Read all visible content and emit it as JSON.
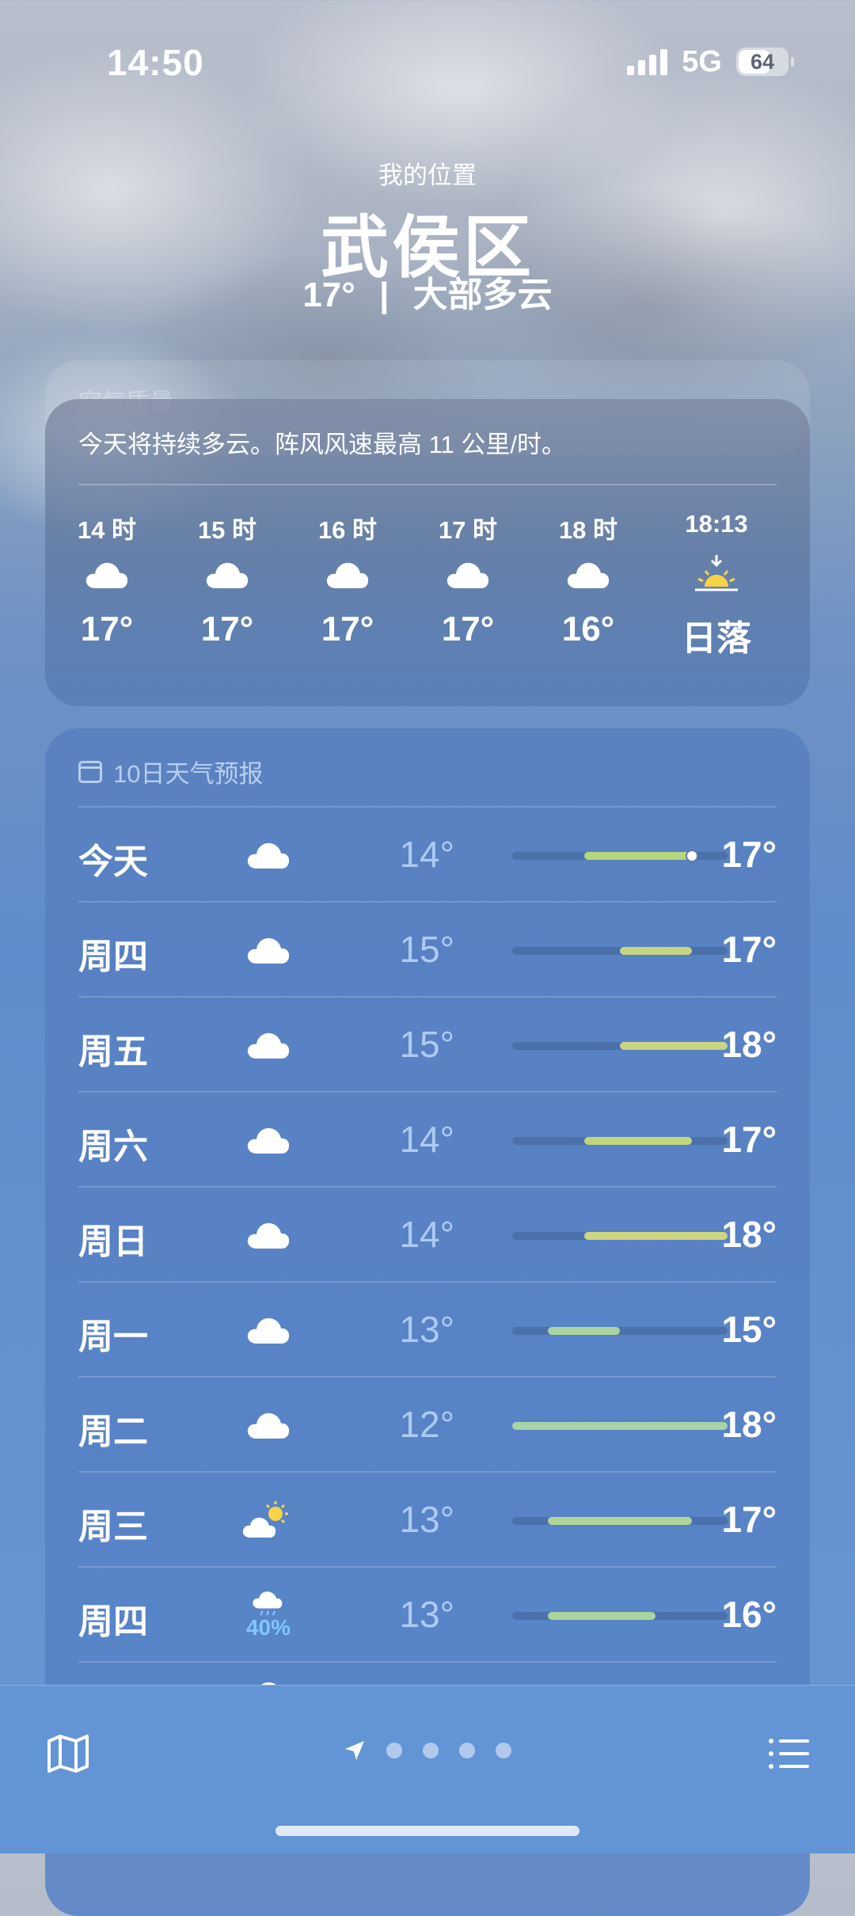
{
  "status": {
    "time": "14:50",
    "network": "5G",
    "battery": "64"
  },
  "header": {
    "location_label": "我的位置",
    "city": "武侯区",
    "temp": "17°",
    "divider": "|",
    "condition": "大部多云"
  },
  "ghost_card": {
    "title": "空气质量"
  },
  "hourly": {
    "summary": "今天将持续多云。阵风风速最高 11 公里/时。",
    "items": [
      {
        "time": "14 时",
        "icon": "cloud-icon",
        "temp": "17°"
      },
      {
        "time": "15 时",
        "icon": "cloud-icon",
        "temp": "17°"
      },
      {
        "time": "16 时",
        "icon": "cloud-icon",
        "temp": "17°"
      },
      {
        "time": "17 时",
        "icon": "cloud-icon",
        "temp": "17°"
      },
      {
        "time": "18 时",
        "icon": "cloud-icon",
        "temp": "16°"
      },
      {
        "time": "18:13",
        "icon": "sunset-icon",
        "temp": "日落"
      }
    ]
  },
  "daily": {
    "title": "10日天气预报",
    "range_min": 12,
    "range_max": 18,
    "current_temp": 17,
    "days": [
      {
        "name": "今天",
        "icon": "cloud-icon",
        "low": "14°",
        "high": "17°",
        "low_v": 14,
        "high_v": 17,
        "color": "#b8d67a",
        "current": true
      },
      {
        "name": "周四",
        "icon": "cloud-icon",
        "low": "15°",
        "high": "17°",
        "low_v": 15,
        "high_v": 17,
        "color": "#c4d680"
      },
      {
        "name": "周五",
        "icon": "cloud-icon",
        "low": "15°",
        "high": "18°",
        "low_v": 15,
        "high_v": 18,
        "color": "#c8d582"
      },
      {
        "name": "周六",
        "icon": "cloud-icon",
        "low": "14°",
        "high": "17°",
        "low_v": 14,
        "high_v": 17,
        "color": "#bfd67e"
      },
      {
        "name": "周日",
        "icon": "cloud-icon",
        "low": "14°",
        "high": "18°",
        "low_v": 14,
        "high_v": 18,
        "color": "#cfd680"
      },
      {
        "name": "周一",
        "icon": "cloud-icon",
        "low": "13°",
        "high": "15°",
        "low_v": 13,
        "high_v": 15,
        "color": "#a9d4a0"
      },
      {
        "name": "周二",
        "icon": "cloud-icon",
        "low": "12°",
        "high": "18°",
        "low_v": 12,
        "high_v": 18,
        "color": "#a8d4a8"
      },
      {
        "name": "周三",
        "icon": "partly-sunny-icon",
        "low": "13°",
        "high": "17°",
        "low_v": 13,
        "high_v": 17,
        "color": "#b0d49a"
      },
      {
        "name": "周四",
        "icon": "rain-icon",
        "prob": "40%",
        "low": "13°",
        "high": "16°",
        "low_v": 13,
        "high_v": 16,
        "color": "#a9d49c"
      }
    ]
  },
  "icons": {
    "map": "map-icon",
    "location": "location-arrow-icon",
    "list": "list-icon"
  }
}
